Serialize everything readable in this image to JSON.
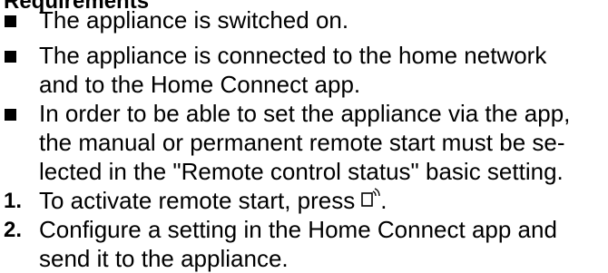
{
  "section": {
    "heading": "Requirements"
  },
  "requirements": [
    {
      "lines": [
        "The appliance is switched on."
      ]
    },
    {
      "lines": [
        "The appliance is connected to the home network",
        "and to the Home Connect app."
      ]
    },
    {
      "lines": [
        "In order to be able to set the appliance via the app,",
        "the manual or permanent remote start must be se-",
        "lected in the \"Remote control status\" basic setting."
      ]
    }
  ],
  "steps": [
    {
      "number": "1.",
      "lines": [
        "To activate remote start, press",
        "."
      ],
      "icon": "remote-start-icon"
    },
    {
      "number": "2.",
      "lines": [
        "Configure a setting in the Home Connect app and",
        "send it to the appliance."
      ]
    }
  ]
}
